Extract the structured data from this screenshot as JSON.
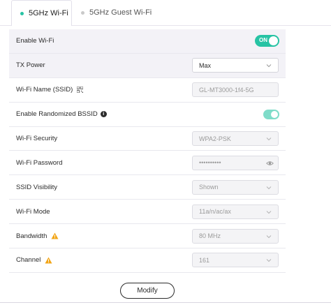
{
  "tabs": [
    {
      "label": "5GHz Wi-Fi",
      "active": true
    },
    {
      "label": "5GHz Guest Wi-Fi",
      "active": false
    }
  ],
  "colors": {
    "accent": "#27c3a4",
    "row_shade": "#f3f2f7"
  },
  "rows": {
    "enable_wifi": {
      "label": "Enable Wi-Fi",
      "toggle_text": "ON",
      "on": true
    },
    "tx_power": {
      "label": "TX Power",
      "value": "Max"
    },
    "ssid": {
      "label": "Wi-Fi Name (SSID)",
      "value": "GL-MT3000-1f4-5G",
      "icon": "qr-code-icon"
    },
    "randomized_bssid": {
      "label": "Enable Randomized BSSID",
      "icon": "info-icon",
      "on": true
    },
    "security": {
      "label": "Wi-Fi Security",
      "value": "WPA2-PSK"
    },
    "password": {
      "label": "Wi-Fi Password",
      "value": "••••••••••",
      "icon": "eye-icon"
    },
    "ssid_visibility": {
      "label": "SSID Visibility",
      "value": "Shown"
    },
    "mode": {
      "label": "Wi-Fi Mode",
      "value": "11a/n/ac/ax"
    },
    "bandwidth": {
      "label": "Bandwidth",
      "value": "80 MHz",
      "icon": "warning-icon"
    },
    "channel": {
      "label": "Channel",
      "value": "161",
      "icon": "warning-icon"
    }
  },
  "modify_label": "Modify"
}
